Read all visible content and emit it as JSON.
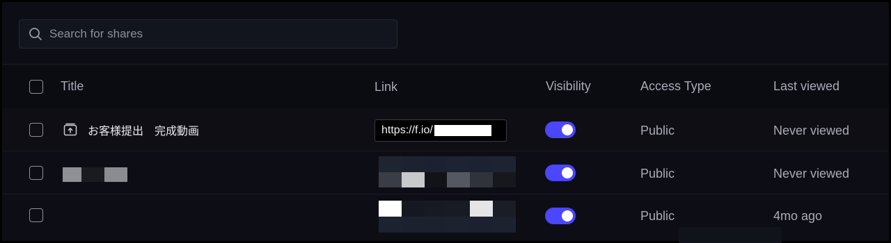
{
  "search": {
    "placeholder": "Search for shares",
    "icon": "search-icon"
  },
  "table": {
    "columns": {
      "title": "Title",
      "link": "Link",
      "visibility": "Visibility",
      "access_type": "Access Type",
      "last_viewed": "Last viewed"
    },
    "rows": [
      {
        "title": "お客様提出　完成動画",
        "icon": "share-link-icon",
        "link_prefix": "https://f.io/",
        "visibility_on": true,
        "access_type": "Public",
        "last_viewed": "Never viewed"
      },
      {
        "title": "",
        "link_prefix": "",
        "visibility_on": true,
        "access_type": "Public",
        "last_viewed": "Never viewed"
      },
      {
        "title": "",
        "link_prefix": "",
        "visibility_on": true,
        "access_type": "Public",
        "last_viewed": "4mo ago"
      }
    ]
  },
  "colors": {
    "accent": "#4b46ff",
    "background": "#0d0d15",
    "text_muted": "#a8aab4"
  }
}
